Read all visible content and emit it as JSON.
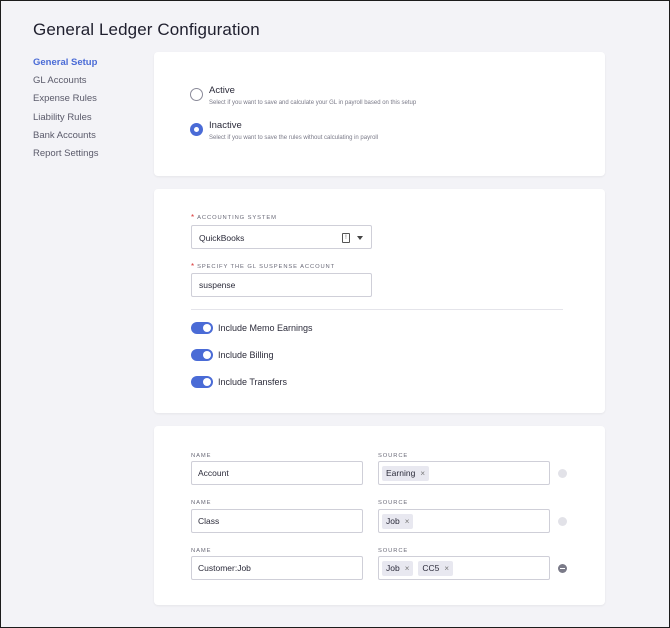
{
  "page": {
    "title": "General Ledger Configuration"
  },
  "sidebar": {
    "items": [
      {
        "label": "General Setup"
      },
      {
        "label": "GL Accounts"
      },
      {
        "label": "Expense Rules"
      },
      {
        "label": "Liability Rules"
      },
      {
        "label": "Bank Accounts"
      },
      {
        "label": "Report Settings"
      }
    ],
    "active_index": 0
  },
  "status": {
    "options": [
      {
        "label": "Active",
        "description": "Select if you want to save and calculate your GL in payroll based on this setup",
        "selected": false
      },
      {
        "label": "Inactive",
        "description": "Select if you want to save the rules without calculating in payroll",
        "selected": true
      }
    ]
  },
  "settings": {
    "accounting_system": {
      "label": "ACCOUNTING SYSTEM",
      "required_mark": "*",
      "value": "QuickBooks"
    },
    "suspense_account": {
      "label": "SPECIFY THE GL SUSPENSE ACCOUNT",
      "required_mark": "*",
      "value": "suspense"
    },
    "toggles": [
      {
        "label": "Include Memo Earnings",
        "on": true
      },
      {
        "label": "Include Billing",
        "on": true
      },
      {
        "label": "Include Transfers",
        "on": true
      }
    ]
  },
  "mappings": {
    "name_label": "NAME",
    "source_label": "SOURCE",
    "remove_glyph": "×",
    "rows": [
      {
        "name": "Account",
        "sources": [
          "Earning"
        ]
      },
      {
        "name": "Class",
        "sources": [
          "Job"
        ]
      },
      {
        "name": "Customer:Job",
        "sources": [
          "Job",
          "CC5"
        ]
      }
    ]
  },
  "icons": {
    "clear": "clear-icon",
    "caret": "chevron-down-icon",
    "remove_row": "minus-circle-icon"
  },
  "colors": {
    "accent": "#4a6bd6",
    "required": "#d93636",
    "background": "#f3f3f7"
  }
}
